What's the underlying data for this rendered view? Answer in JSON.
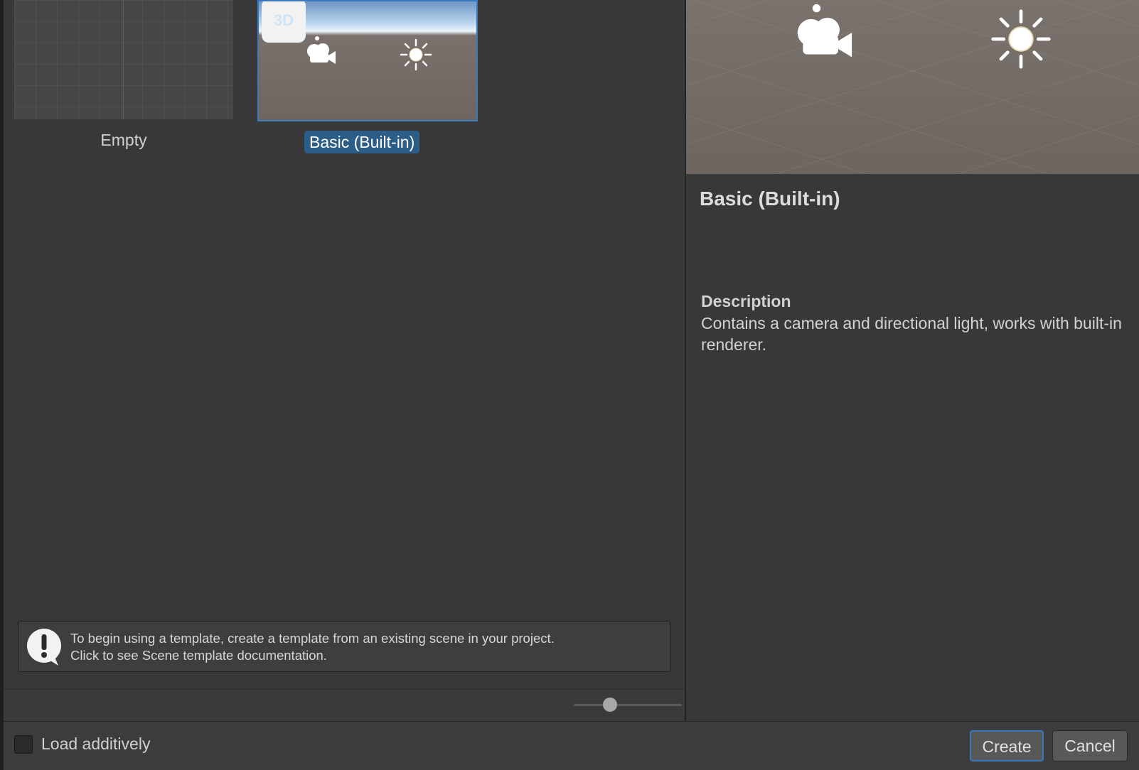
{
  "templates": [
    {
      "label": "Empty",
      "selected": false
    },
    {
      "label": "Basic (Built-in)",
      "selected": true,
      "badge": "3D"
    }
  ],
  "notice": {
    "text": "To begin using a template, create a template from an existing scene in your project.\nClick to see Scene template documentation."
  },
  "zoom_slider": {
    "value": 0.35
  },
  "details": {
    "title": "Basic (Built-in)",
    "description_label": "Description",
    "description": "Contains a camera and directional light, works with built-in renderer."
  },
  "footer": {
    "load_additively_label": "Load additively",
    "load_additively_checked": false,
    "create_label": "Create",
    "cancel_label": "Cancel"
  },
  "colors": {
    "selection": "#2c5d87",
    "accent_border": "#3a79bb",
    "panel": "#383838"
  }
}
